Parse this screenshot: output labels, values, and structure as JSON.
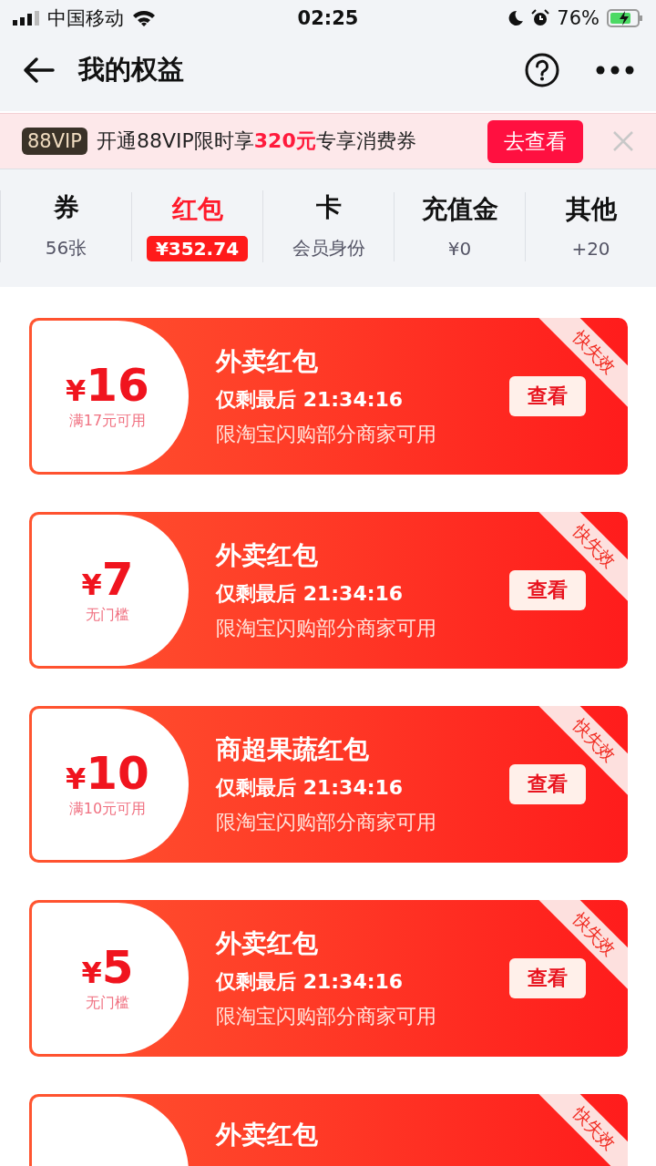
{
  "status_bar": {
    "carrier": "中国移动",
    "time": "02:25",
    "battery": "76%"
  },
  "nav": {
    "title": "我的权益"
  },
  "banner": {
    "badge": "88VIP",
    "text": "开通88VIP限时享**320元**专享消费券",
    "button": "去查看"
  },
  "tabs": [
    {
      "label": "券",
      "sub": "56张",
      "selected": false
    },
    {
      "label": "红包",
      "sub": "¥352.74",
      "selected": true
    },
    {
      "label": "卡",
      "sub": "会员身份",
      "selected": false
    },
    {
      "label": "充值金",
      "sub": "¥0",
      "selected": false
    },
    {
      "label": "其他",
      "sub": "+20",
      "selected": false
    }
  ],
  "cards": [
    {
      "currency": "¥",
      "amount": "16",
      "condition": "满17元可用",
      "title": "外卖红包",
      "countdown": "仅剩最后 21:34:16",
      "scope": "限淘宝闪购部分商家可用",
      "button": "查看",
      "tag": "快失效"
    },
    {
      "currency": "¥",
      "amount": "7",
      "condition": "无门槛",
      "title": "外卖红包",
      "countdown": "仅剩最后 21:34:16",
      "scope": "限淘宝闪购部分商家可用",
      "button": "查看",
      "tag": "快失效"
    },
    {
      "currency": "¥",
      "amount": "10",
      "condition": "满10元可用",
      "title": "商超果蔬红包",
      "countdown": "仅剩最后 21:34:16",
      "scope": "限淘宝闪购部分商家可用",
      "button": "查看",
      "tag": "快失效"
    },
    {
      "currency": "¥",
      "amount": "5",
      "condition": "无门槛",
      "title": "外卖红包",
      "countdown": "仅剩最后 21:34:16",
      "scope": "限淘宝闪购部分商家可用",
      "button": "查看",
      "tag": "快失效"
    },
    {
      "title": "外卖红包",
      "tag": "快失效"
    }
  ]
}
